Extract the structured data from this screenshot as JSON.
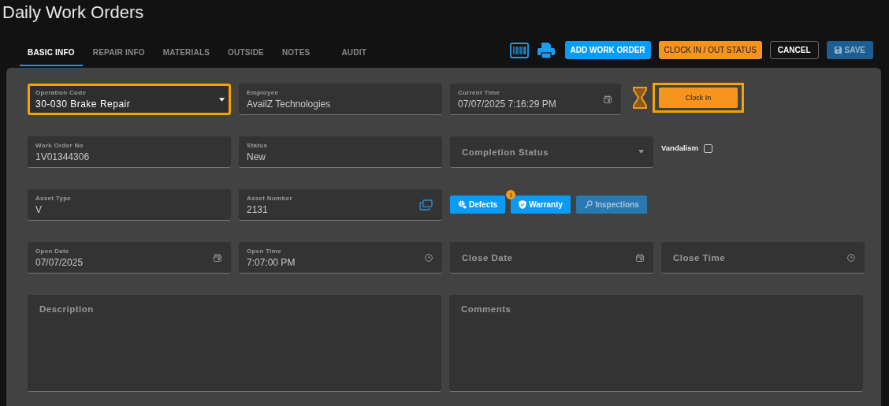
{
  "page": {
    "title": "Daily Work Orders"
  },
  "tabs": [
    {
      "label": "BASIC INFO",
      "selected": true
    },
    {
      "label": "REPAIR INFO",
      "selected": false
    },
    {
      "label": "MATERIALS",
      "selected": false
    },
    {
      "label": "OUTSIDE",
      "selected": false
    },
    {
      "label": "NOTES",
      "selected": false
    },
    {
      "label": "AUDIT",
      "selected": false
    }
  ],
  "toolbar": [
    {
      "kind": "barcode"
    },
    {
      "kind": "printer"
    },
    {
      "kind": "primary",
      "label": "ADD WORK ORDER"
    },
    {
      "kind": "accent",
      "label": "CLOCK IN / OUT STATUS"
    },
    {
      "kind": "outline",
      "label": "CANCEL"
    },
    {
      "kind": "save",
      "label": "SAVE",
      "disabled": true
    }
  ],
  "rows": [
    {
      "items": [
        {
          "kind": "select",
          "label": "Operation Code",
          "value": "30-030 Brake Repair",
          "focused": true
        },
        {
          "kind": "input",
          "label": "Employee",
          "value": "AvailZ Technologies",
          "focused": false
        },
        {
          "kind": "date",
          "label": "Current Time",
          "value": "07/07/2025 7:16:29 PM",
          "focused": false
        },
        {
          "kind": "clock",
          "label": "Clock In",
          "focused": true
        }
      ]
    },
    {
      "items": [
        {
          "kind": "input",
          "label": "Work Order No",
          "value": "1V01344306",
          "focused": false
        },
        {
          "kind": "input",
          "label": "Status",
          "value": "New",
          "focused": false
        },
        {
          "kind": "select",
          "placeholder": "Completion Status",
          "focused": false
        },
        {
          "kind": "checkbox",
          "label": "Vandalism",
          "checked": false
        }
      ]
    },
    {
      "items": [
        {
          "kind": "input",
          "label": "Asset Type",
          "value": "V",
          "focused": false
        },
        {
          "kind": "lookup",
          "label": "Asset Number",
          "value": "2131",
          "focused": false
        },
        {
          "kind": "buttons",
          "buttons": [
            {
              "label": "Defects",
              "disabled": false
            },
            {
              "label": "Warranty",
              "badge": "1",
              "disabled": false
            },
            {
              "label": "Inspections",
              "disabled": true
            }
          ]
        }
      ]
    },
    {
      "items": [
        {
          "kind": "date",
          "label": "Open Date",
          "value": "07/07/2025",
          "focused": false
        },
        {
          "kind": "time",
          "label": "Open Time",
          "value": "7:07:00 PM",
          "focused": false
        },
        {
          "kind": "date",
          "placeholder": "Close Date",
          "focused": false
        },
        {
          "kind": "time",
          "placeholder": "Close Time",
          "focused": false
        }
      ]
    },
    {
      "items": [
        {
          "kind": "textarea",
          "placeholder": "Description",
          "focused": false
        },
        {
          "kind": "textarea",
          "placeholder": "Comments",
          "focused": false
        }
      ]
    }
  ]
}
